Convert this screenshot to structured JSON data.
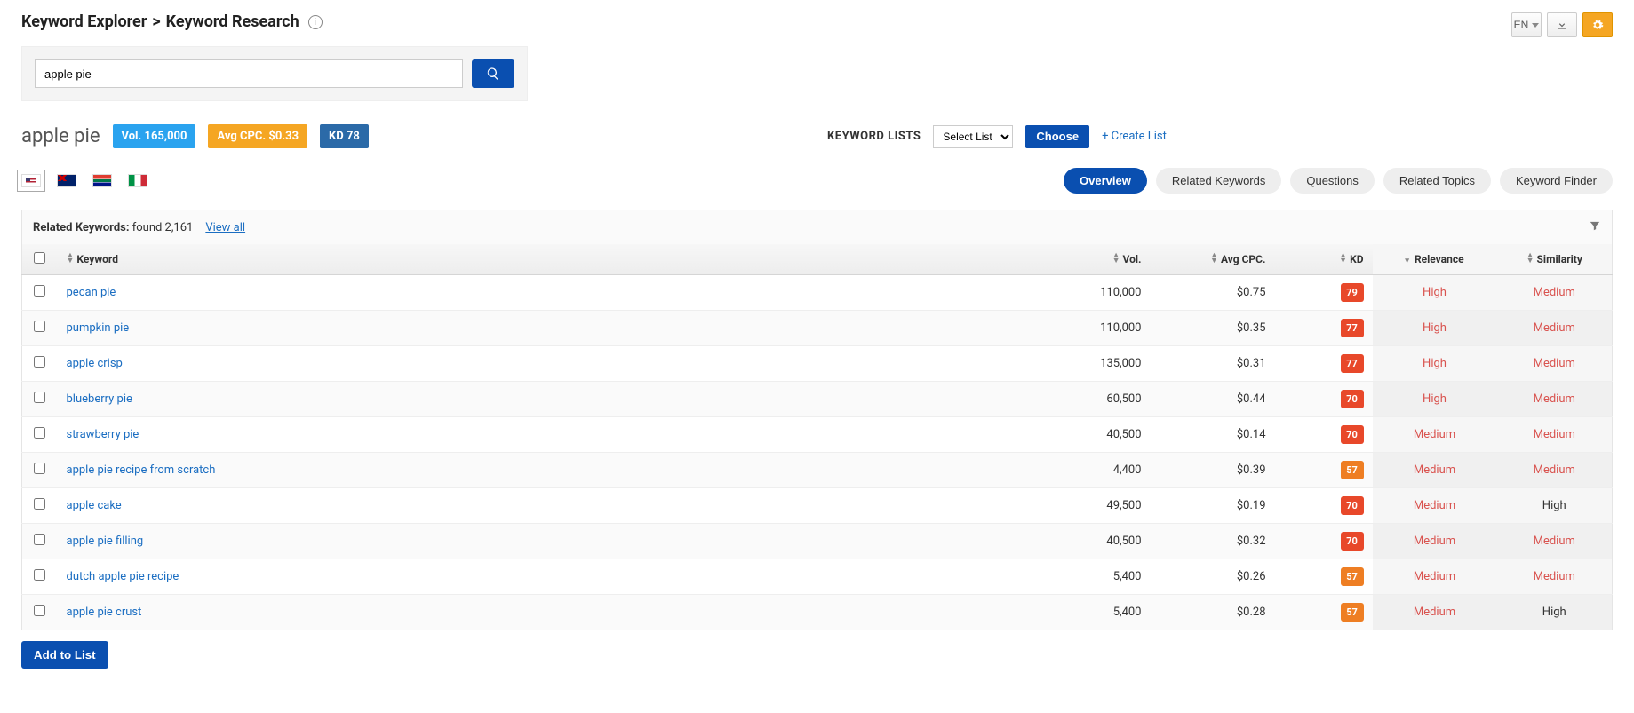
{
  "breadcrumb": {
    "part1": "Keyword Explorer",
    "sep": ">",
    "part2": "Keyword Research"
  },
  "langBtn": "EN",
  "search": {
    "value": "apple pie"
  },
  "keyword": {
    "title": "apple pie",
    "volBadge": "Vol. 165,000",
    "cpcBadge": "Avg CPC. $0.33",
    "kdBadge": "KD 78"
  },
  "keywordLists": {
    "label": "KEYWORD LISTS",
    "selectPlaceholder": "Select List",
    "chooseLabel": "Choose",
    "createLabel": "+ Create List"
  },
  "flags": [
    "us",
    "au",
    "za",
    "it"
  ],
  "tabs": [
    {
      "label": "Overview",
      "active": true
    },
    {
      "label": "Related Keywords",
      "active": false
    },
    {
      "label": "Questions",
      "active": false
    },
    {
      "label": "Related Topics",
      "active": false
    },
    {
      "label": "Keyword Finder",
      "active": false
    }
  ],
  "relatedHeader": {
    "titleBold": "Related Keywords:",
    "found": "found 2,161",
    "viewAll": "View all"
  },
  "columns": {
    "keyword": "Keyword",
    "vol": "Vol.",
    "cpc": "Avg CPC.",
    "kd": "KD",
    "rel": "Relevance",
    "sim": "Similarity"
  },
  "rows": [
    {
      "kw": "pecan pie",
      "vol": "110,000",
      "cpc": "$0.75",
      "kd": "79",
      "kdClass": "kd-red",
      "rel": "High",
      "relClass": "cell-warn",
      "sim": "Medium",
      "simClass": "cell-warn"
    },
    {
      "kw": "pumpkin pie",
      "vol": "110,000",
      "cpc": "$0.35",
      "kd": "77",
      "kdClass": "kd-red",
      "rel": "High",
      "relClass": "cell-warn",
      "sim": "Medium",
      "simClass": "cell-warn"
    },
    {
      "kw": "apple crisp",
      "vol": "135,000",
      "cpc": "$0.31",
      "kd": "77",
      "kdClass": "kd-red",
      "rel": "High",
      "relClass": "cell-warn",
      "sim": "Medium",
      "simClass": "cell-warn"
    },
    {
      "kw": "blueberry pie",
      "vol": "60,500",
      "cpc": "$0.44",
      "kd": "70",
      "kdClass": "kd-red",
      "rel": "High",
      "relClass": "cell-warn",
      "sim": "Medium",
      "simClass": "cell-warn"
    },
    {
      "kw": "strawberry pie",
      "vol": "40,500",
      "cpc": "$0.14",
      "kd": "70",
      "kdClass": "kd-red",
      "rel": "Medium",
      "relClass": "cell-warn",
      "sim": "Medium",
      "simClass": "cell-warn"
    },
    {
      "kw": "apple pie recipe from scratch",
      "vol": "4,400",
      "cpc": "$0.39",
      "kd": "57",
      "kdClass": "kd-orange",
      "rel": "Medium",
      "relClass": "cell-warn",
      "sim": "Medium",
      "simClass": "cell-warn"
    },
    {
      "kw": "apple cake",
      "vol": "49,500",
      "cpc": "$0.19",
      "kd": "70",
      "kdClass": "kd-red",
      "rel": "Medium",
      "relClass": "cell-warn",
      "sim": "High",
      "simClass": "cell-dark"
    },
    {
      "kw": "apple pie filling",
      "vol": "40,500",
      "cpc": "$0.32",
      "kd": "70",
      "kdClass": "kd-red",
      "rel": "Medium",
      "relClass": "cell-warn",
      "sim": "Medium",
      "simClass": "cell-warn"
    },
    {
      "kw": "dutch apple pie recipe",
      "vol": "5,400",
      "cpc": "$0.26",
      "kd": "57",
      "kdClass": "kd-orange",
      "rel": "Medium",
      "relClass": "cell-warn",
      "sim": "Medium",
      "simClass": "cell-warn"
    },
    {
      "kw": "apple pie crust",
      "vol": "5,400",
      "cpc": "$0.28",
      "kd": "57",
      "kdClass": "kd-orange",
      "rel": "Medium",
      "relClass": "cell-warn",
      "sim": "High",
      "simClass": "cell-dark"
    }
  ],
  "addToList": "Add to List"
}
